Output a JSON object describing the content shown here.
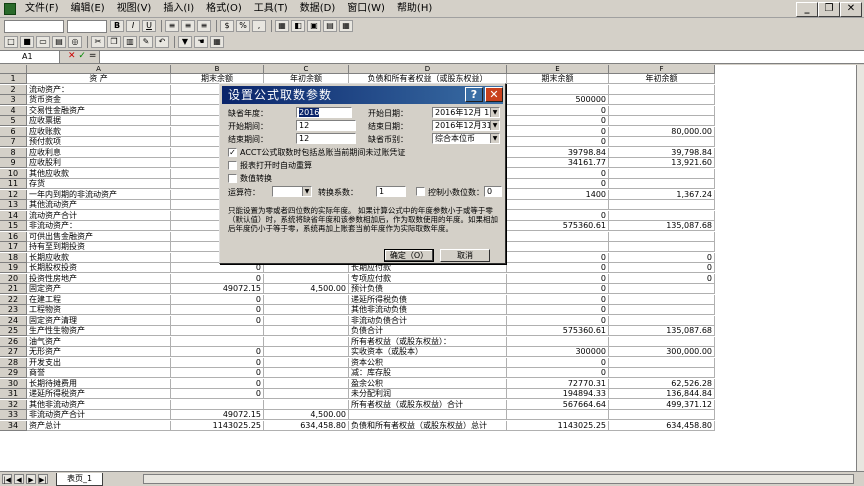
{
  "menu": [
    "文件(F)",
    "编辑(E)",
    "视图(V)",
    "插入(I)",
    "格式(O)",
    "工具(T)",
    "数据(D)",
    "窗口(W)",
    "帮助(H)"
  ],
  "namebox": "A1",
  "columns": [
    "A",
    "B",
    "C",
    "D",
    "E",
    "F"
  ],
  "header_row": {
    "a": "资          产",
    "b": "期末余额",
    "c": "年初余额",
    "d": "负债和所有者权益（或股东权益）",
    "e": "期末余额",
    "f": "年初余额"
  },
  "rows": [
    {
      "n": "2",
      "a": "流动资产：",
      "b": "",
      "c": "",
      "d": "",
      "e": "",
      "f": ""
    },
    {
      "n": "3",
      "a": "    货币资金",
      "b": "",
      "c": "",
      "d": "",
      "e": "500000",
      "f": ""
    },
    {
      "n": "4",
      "a": "    交易性金融资产",
      "b": "",
      "c": "",
      "d": "",
      "e": "0",
      "f": ""
    },
    {
      "n": "5",
      "a": "    应收票据",
      "b": "",
      "c": "",
      "d": "",
      "e": "0",
      "f": ""
    },
    {
      "n": "6",
      "a": "    应收账款",
      "b": "",
      "c": "",
      "d": "",
      "e": "0",
      "f": "80,000.00"
    },
    {
      "n": "7",
      "a": "    预付款项",
      "b": "",
      "c": "",
      "d": "",
      "e": "0",
      "f": ""
    },
    {
      "n": "8",
      "a": "    应收利息",
      "b": "",
      "c": "",
      "d": "",
      "e": "39798.84",
      "f": "39,798.84"
    },
    {
      "n": "9",
      "a": "    应收股利",
      "b": "",
      "c": "",
      "d": "",
      "e": "34161.77",
      "f": "13,921.60"
    },
    {
      "n": "10",
      "a": "    其他应收款",
      "b": "",
      "c": "",
      "d": "",
      "e": "0",
      "f": ""
    },
    {
      "n": "11",
      "a": "    存货",
      "b": "",
      "c": "",
      "d": "",
      "e": "0",
      "f": ""
    },
    {
      "n": "12",
      "a": "    一年内到期的非流动资产",
      "b": "",
      "c": "",
      "d": "",
      "e": "1400",
      "f": "1,367.24"
    },
    {
      "n": "13",
      "a": "    其他流动资产",
      "b": "",
      "c": "",
      "d": "",
      "e": "",
      "f": ""
    },
    {
      "n": "14",
      "a": "      流动资产合计",
      "b": "",
      "c": "",
      "d": "",
      "e": "0",
      "f": ""
    },
    {
      "n": "15",
      "a": "非流动资产：",
      "b": "",
      "c": "",
      "d": "",
      "e": "575360.61",
      "f": "135,087.68"
    },
    {
      "n": "16",
      "a": "    可供出售金融资产",
      "b": "",
      "c": "",
      "d": "",
      "e": "",
      "f": ""
    },
    {
      "n": "17",
      "a": "    持有至到期投资",
      "b": "",
      "c": "",
      "d": "",
      "e": "",
      "f": ""
    },
    {
      "n": "18",
      "a": "    长期应收款",
      "b": "",
      "c": "",
      "d": "",
      "e": "0",
      "f": "0"
    },
    {
      "n": "19",
      "a": "    长期股权投资",
      "b": "0",
      "c": "",
      "d": "    长期应付款",
      "e": "0",
      "f": "0"
    },
    {
      "n": "20",
      "a": "    投资性房地产",
      "b": "0",
      "c": "",
      "d": "    专项应付款",
      "e": "0",
      "f": "0"
    },
    {
      "n": "21",
      "a": "    固定资产",
      "b": "49072.15",
      "c": "4,500.00",
      "d": "    预计负债",
      "e": "0",
      "f": ""
    },
    {
      "n": "22",
      "a": "    在建工程",
      "b": "0",
      "c": "",
      "d": "    递延所得税负债",
      "e": "0",
      "f": ""
    },
    {
      "n": "23",
      "a": "    工程物资",
      "b": "0",
      "c": "",
      "d": "    其他非流动负债",
      "e": "0",
      "f": ""
    },
    {
      "n": "24",
      "a": "    固定资产清理",
      "b": "0",
      "c": "",
      "d": "      非流动负债合计",
      "e": "0",
      "f": ""
    },
    {
      "n": "25",
      "a": "    生产性生物资产",
      "b": "",
      "c": "",
      "d": "      负债合计",
      "e": "575360.61",
      "f": "135,087.68"
    },
    {
      "n": "26",
      "a": "    油气资产",
      "b": "",
      "c": "",
      "d": "所有者权益（或股东权益）：",
      "e": "",
      "f": ""
    },
    {
      "n": "27",
      "a": "    无形资产",
      "b": "0",
      "c": "",
      "d": "    实收资本（或股本）",
      "e": "300000",
      "f": "300,000.00"
    },
    {
      "n": "28",
      "a": "    开发支出",
      "b": "0",
      "c": "",
      "d": "    资本公积",
      "e": "0",
      "f": ""
    },
    {
      "n": "29",
      "a": "    商誉",
      "b": "0",
      "c": "",
      "d": "    减：库存股",
      "e": "0",
      "f": ""
    },
    {
      "n": "30",
      "a": "    长期待摊费用",
      "b": "0",
      "c": "",
      "d": "    盈余公积",
      "e": "72770.31",
      "f": "62,526.28"
    },
    {
      "n": "31",
      "a": "    递延所得税资产",
      "b": "0",
      "c": "",
      "d": "    未分配利润",
      "e": "194894.33",
      "f": "136,844.84"
    },
    {
      "n": "32",
      "a": "    其他非流动资产",
      "b": "",
      "c": "",
      "d": "    所有者权益（或股东权益）合计",
      "e": "567664.64",
      "f": "499,371.12"
    },
    {
      "n": "33",
      "a": "      非流动资产合计",
      "b": "49072.15",
      "c": "4,500.00",
      "d": "",
      "e": "",
      "f": ""
    },
    {
      "n": "34",
      "a": "资产总计",
      "b": "1143025.25",
      "c": "634,458.80",
      "d": "负债和所有者权益（或股东权益）总计",
      "e": "1143025.25",
      "f": "634,458.80"
    }
  ],
  "dialog": {
    "title": "设置公式取数参数",
    "default_year_label": "缺省年度：",
    "default_year": "2016",
    "start_date_label": "开始日期：",
    "start_date": "2016年12月 1日",
    "start_period_label": "开始期间：",
    "start_period": "12",
    "end_date_label": "结束日期：",
    "end_date": "2016年12月31日",
    "end_period_label": "结束期间：",
    "end_period": "12",
    "currency_label": "缺省币别：",
    "currency": "综合本位币",
    "opt1": "ACCT公式取数时包括总账当前期间未过账凭证",
    "opt1_checked": true,
    "opt2": "报表打开时自动重算",
    "opt2_checked": false,
    "opt3": "数值转换",
    "opt3_checked": false,
    "operator_label": "运算符：",
    "coef_label": "转换系数：",
    "coef": "1",
    "decimals_label": "控制小数位数：",
    "decimals": "0",
    "note": "只能设置为零或者四位数的实际年度。 如果计算公式中的年度参数小于或等于零（默认值）时，系统将缺省年度和该参数相加后，作为取数使用的年度。如果相加后年度仍小于等于零，系统再加上账套当前年度作为实际取数年度。",
    "ok": "确定（O）",
    "cancel": "取消"
  },
  "sheet_tab": "表页_1"
}
